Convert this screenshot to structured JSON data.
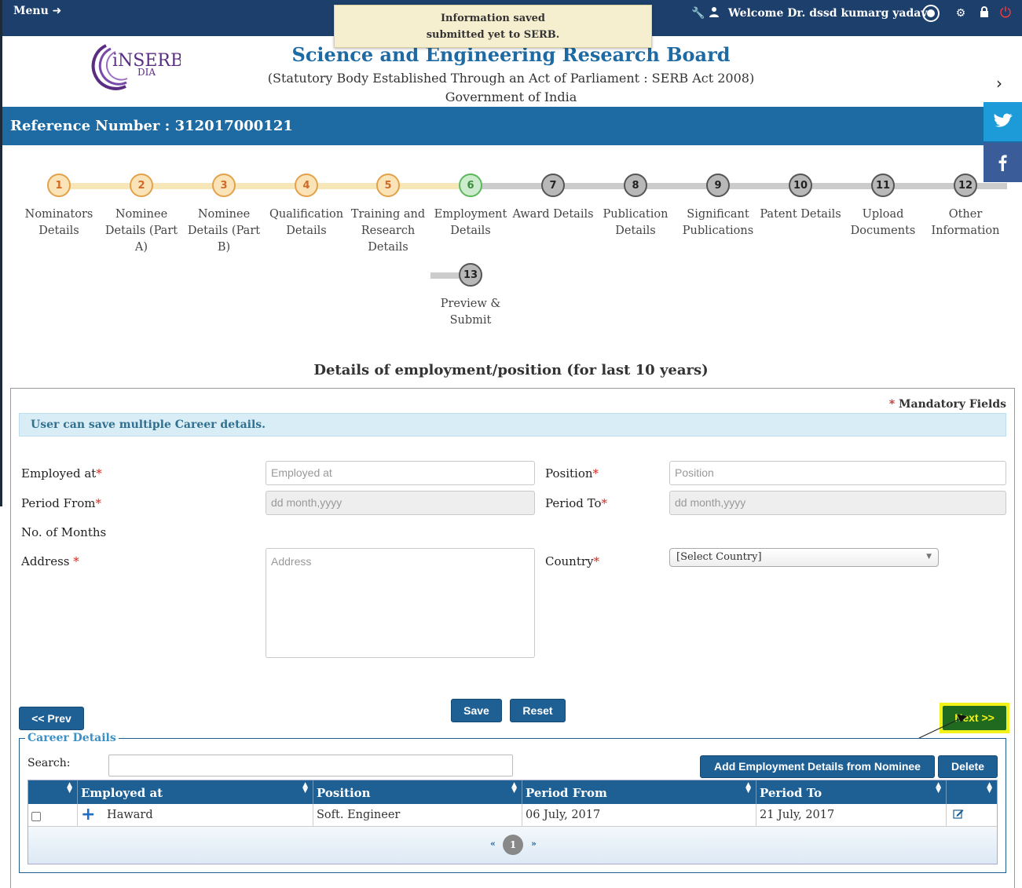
{
  "topbar": {
    "menu_label": "Menu",
    "welcome": "Welcome Dr. dssd kumarg yadavs"
  },
  "toast": {
    "line1": "Information saved",
    "line2": "submitted yet to SERB."
  },
  "header": {
    "logo_text_1": "iNSERB",
    "logo_text_2": "DIA",
    "title": "Science and Engineering Research Board",
    "subtitle": "(Statutory Body Established Through an Act of Parliament : SERB Act 2008)",
    "subtitle2": "Government of India"
  },
  "reference": "Reference Number : 312017000121",
  "steps": [
    {
      "num": "1",
      "label": "Nominators Details",
      "state": "done"
    },
    {
      "num": "2",
      "label": "Nominee Details (Part A)",
      "state": "done"
    },
    {
      "num": "3",
      "label": "Nominee Details (Part B)",
      "state": "done"
    },
    {
      "num": "4",
      "label": "Qualification Details",
      "state": "done"
    },
    {
      "num": "5",
      "label": "Training and Research Details",
      "state": "done"
    },
    {
      "num": "6",
      "label": "Employment Details",
      "state": "current"
    },
    {
      "num": "7",
      "label": "Award Details",
      "state": "todo"
    },
    {
      "num": "8",
      "label": "Publication Details",
      "state": "todo"
    },
    {
      "num": "9",
      "label": "Significant Publications",
      "state": "todo"
    },
    {
      "num": "10",
      "label": "Patent Details",
      "state": "todo"
    },
    {
      "num": "11",
      "label": "Upload Documents",
      "state": "todo"
    },
    {
      "num": "12",
      "label": "Other Information",
      "state": "todo"
    },
    {
      "num": "13",
      "label": "Preview & Submit",
      "state": "todo"
    }
  ],
  "section_title": "Details of employment/position (for last 10 years)",
  "mandatory": "Mandatory Fields",
  "info": "User can save multiple Career details.",
  "form": {
    "employed_at_label": "Employed at",
    "employed_at_placeholder": "Employed at",
    "position_label": "Position",
    "position_placeholder": "Position",
    "period_from_label": "Period From",
    "period_from_placeholder": "dd month,yyyy",
    "period_to_label": "Period To",
    "period_to_placeholder": "dd month,yyyy",
    "months_label": "No. of Months",
    "address_label": "Address",
    "address_placeholder": "Address",
    "country_label": "Country",
    "country_value": "[Select Country]"
  },
  "buttons": {
    "prev": "<< Prev",
    "save": "Save",
    "reset": "Reset",
    "next": "Next >>",
    "add_from_nominee": "Add Employment Details from Nominee",
    "delete": "Delete"
  },
  "career": {
    "legend": "Career Details",
    "search_label": "Search:",
    "columns": [
      "Employed at",
      "Position",
      "Period From",
      "Period To"
    ],
    "rows": [
      {
        "employed_at": "Haward",
        "position": "Soft. Engineer",
        "from": "06 July, 2017",
        "to": "21 July, 2017"
      }
    ],
    "pager": {
      "prev": "«",
      "page": "1",
      "next": "»"
    }
  },
  "colors": {
    "topbar": "#1c3f6b",
    "brand_blue": "#1e6aa3",
    "button": "#1e5f94",
    "step_done": "#e2a24c",
    "step_current": "#5cb85c",
    "next_highlight": "#f2f21a"
  }
}
